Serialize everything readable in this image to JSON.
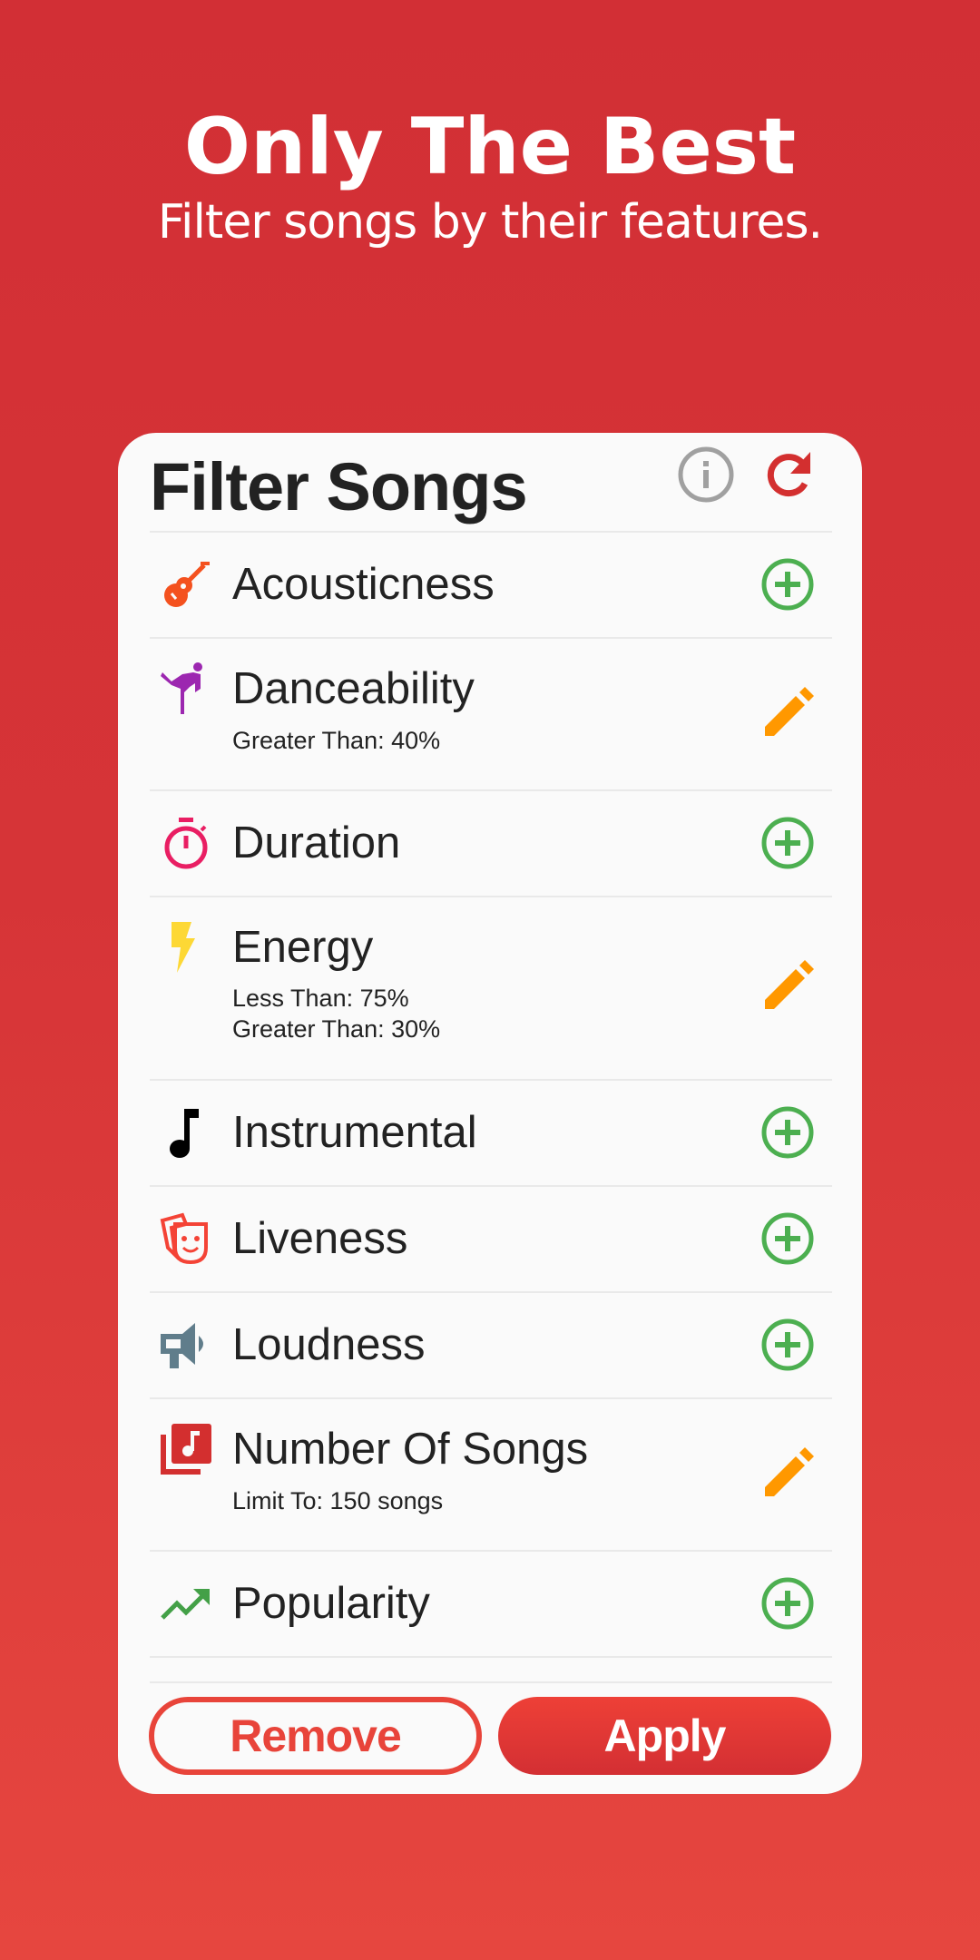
{
  "hero": {
    "title": "Only The Best",
    "subtitle": "Filter songs by their features."
  },
  "card": {
    "title": "Filter Songs",
    "header_icons": {
      "info": "info-icon",
      "reset": "refresh-icon"
    },
    "filters": [
      {
        "label": "Acousticness",
        "icon": "guitar-icon",
        "icon_color": "#F4511E",
        "action": "add",
        "conditions": []
      },
      {
        "label": "Danceability",
        "icon": "dance-icon",
        "icon_color": "#9C27B0",
        "action": "edit",
        "conditions": [
          "Greater Than: 40%"
        ]
      },
      {
        "label": "Duration",
        "icon": "timer-icon",
        "icon_color": "#E91E63",
        "action": "add",
        "conditions": []
      },
      {
        "label": "Energy",
        "icon": "lightning-icon",
        "icon_color": "#FDD835",
        "action": "edit",
        "conditions": [
          "Less Than: 75%",
          "Greater Than: 30%"
        ]
      },
      {
        "label": "Instrumental",
        "icon": "music-note-icon",
        "icon_color": "#000000",
        "action": "add",
        "conditions": []
      },
      {
        "label": "Liveness",
        "icon": "theater-masks-icon",
        "icon_color": "#F44336",
        "action": "add",
        "conditions": []
      },
      {
        "label": "Loudness",
        "icon": "megaphone-icon",
        "icon_color": "#607D8B",
        "action": "add",
        "conditions": []
      },
      {
        "label": "Number Of Songs",
        "icon": "music-library-icon",
        "icon_color": "#D32F2F",
        "action": "edit",
        "conditions": [
          "Limit To: 150 songs"
        ]
      },
      {
        "label": "Popularity",
        "icon": "trending-up-icon",
        "icon_color": "#43A047",
        "action": "add",
        "conditions": []
      }
    ]
  },
  "buttons": {
    "remove": "Remove",
    "apply": "Apply"
  },
  "colors": {
    "background_top": "#D22F35",
    "background_bottom": "#E6463F",
    "card": "#FAFAFA",
    "add_action": "#4CAF50",
    "edit_action": "#FF9800",
    "info_icon": "#9E9E9E",
    "reset_icon": "#D32F2F",
    "primary": "#E8443A"
  }
}
